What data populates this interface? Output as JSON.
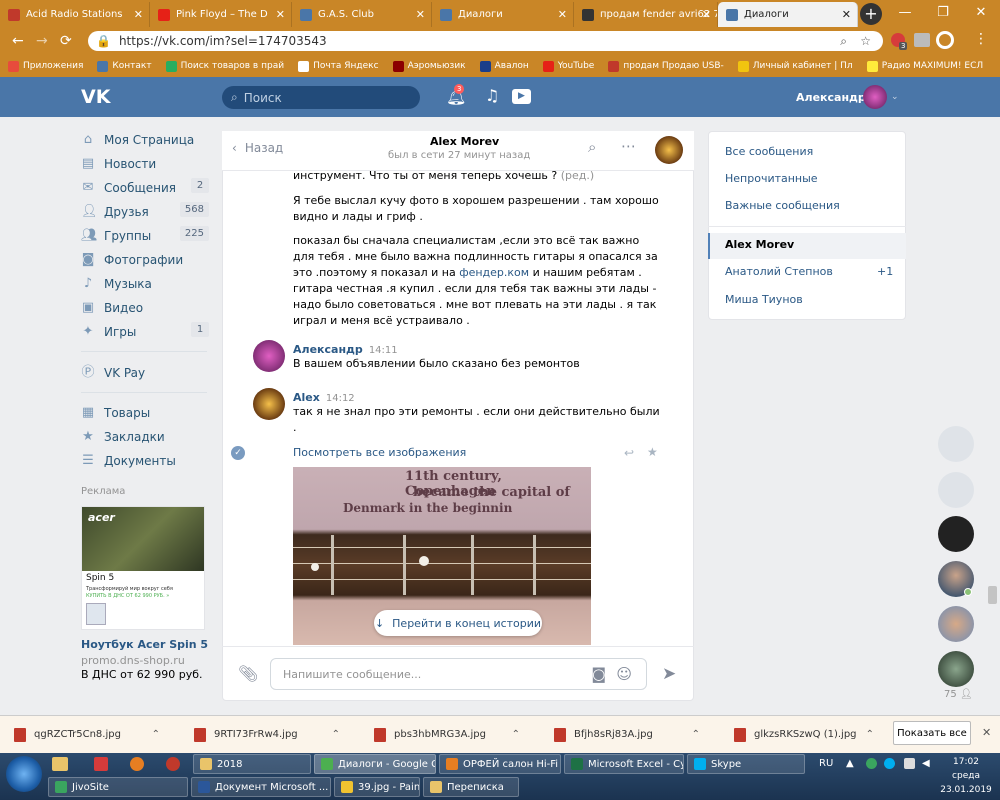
{
  "browser": {
    "tabs": [
      "Acid Radio Stations",
      "Pink Floyd – The D",
      "G.A.S. Club",
      "Диалоги",
      "продам fender avri62 7",
      "Диалоги"
    ],
    "url": "https://vk.com/im?sel=174703543",
    "bookmarks": [
      "Приложения",
      "Контакт",
      "Поиск товаров в прай",
      "Почта Яндекс",
      "Аэромьюзик",
      "Авалон",
      "YouTube",
      "продам Продаю USB-",
      "Личный кабинет | Пл",
      "Радио MAXIMUM! ЕСЛ"
    ],
    "extension_badge": "3"
  },
  "vk": {
    "logo": "VK",
    "search_placeholder": "Поиск",
    "notifications_count": "3",
    "user_name": "Александр"
  },
  "sidebar": {
    "items": [
      {
        "label": "Моя Страница",
        "icon": "home-icon",
        "badge": ""
      },
      {
        "label": "Новости",
        "icon": "news-icon",
        "badge": ""
      },
      {
        "label": "Сообщения",
        "icon": "messages-icon",
        "badge": "2"
      },
      {
        "label": "Друзья",
        "icon": "friends-icon",
        "badge": "568"
      },
      {
        "label": "Группы",
        "icon": "groups-icon",
        "badge": "225"
      },
      {
        "label": "Фотографии",
        "icon": "camera-icon",
        "badge": ""
      },
      {
        "label": "Музыка",
        "icon": "music-icon",
        "badge": ""
      },
      {
        "label": "Видео",
        "icon": "video-icon",
        "badge": ""
      },
      {
        "label": "Игры",
        "icon": "games-icon",
        "badge": "1"
      },
      {
        "label": "VK Pay",
        "icon": "vkpay-icon",
        "badge": ""
      },
      {
        "label": "Товары",
        "icon": "shop-icon",
        "badge": ""
      },
      {
        "label": "Закладки",
        "icon": "star-icon",
        "badge": ""
      },
      {
        "label": "Документы",
        "icon": "document-icon",
        "badge": ""
      }
    ],
    "ad": {
      "heading": "Реклама",
      "brand": "acer",
      "model": "Spin 5",
      "tagline": "Трансформируй мир вокруг себя",
      "price_line": "КУПИТЬ В ДНС ОТ 62 990 РУБ. »",
      "title": "Ноутбук Acer Spin 5",
      "domain": "promo.dns-shop.ru",
      "price": "В ДНС от 62 990 руб."
    }
  },
  "chat": {
    "back_label": "Назад",
    "contact_name": "Alex Morev",
    "last_seen": "был в сети 27 минут назад",
    "messages": {
      "m0_line": "инструмент. Что ты от меня теперь хочешь ?",
      "m0_edited": "(ред.)",
      "m1": [
        "Я тебе выслал кучу фото в хорошем разрешении . там хорошо",
        "видно и лады и гриф ."
      ],
      "m2": [
        "показал бы сначала специалистам ,если это всё так важно",
        "для тебя . мне было важна подлинность гитары я опасался за",
        "это .поэтому я показал и на",
        "фендер.ком",
        "и нашим ребятам .",
        "гитара честная .я купил . если для тебя так важны эти лады -",
        "надо было советоваться . мне вот плевать на эти лады . я так",
        "играл и меня всё устраивало ."
      ],
      "m3_author": "Александр",
      "m3_time": "14:11",
      "m3_text": "В вашем объявлении было сказано без ремонтов",
      "m4_author": "Alex",
      "m4_time": "14:12",
      "m4_text": [
        "так я не знал про эти ремонты . если они действительно были",
        "."
      ],
      "view_images": "Посмотреть все изображения",
      "photo_text": [
        "11th century, Copenhagen",
        "became the capital of",
        "Denmark in the beginnin"
      ]
    },
    "scroll_end_label": "Перейти в конец истории",
    "composer_placeholder": "Напишите сообщение..."
  },
  "right_panel": {
    "filters": [
      "Все сообщения",
      "Непрочитанные",
      "Важные сообщения"
    ],
    "dialogs": [
      {
        "name": "Alex Morev",
        "badge": ""
      },
      {
        "name": "Анатолий Степнов",
        "badge": "+1"
      },
      {
        "name": "Миша Тиунов",
        "badge": ""
      }
    ]
  },
  "floating": {
    "online_count": "75"
  },
  "downloads": {
    "files": [
      "qgRZCTr5Cn8.jpg",
      "9RTI73FrRw4.jpg",
      "pbs3hbMRG3A.jpg",
      "Bfjh8sRj83A.jpg",
      "glkzsRKSzwQ (1).jpg"
    ],
    "show_all": "Показать все"
  },
  "taskbar": {
    "row1": [
      "2018",
      "Диалоги - Google C...",
      "ОРФЕЙ салон Hi-Fi ...",
      "Microsoft Excel - Су...",
      "Skype"
    ],
    "row2": [
      "JivoSite",
      "Документ Microsoft ...",
      "39.jpg - Paint",
      "Переписка"
    ],
    "lang": "RU",
    "time": "17:02",
    "day": "среда",
    "date": "23.01.2019"
  },
  "colors": {
    "vk_blue": "#4a76a8",
    "browser_orange": "#c98627",
    "link": "#2a5885"
  }
}
